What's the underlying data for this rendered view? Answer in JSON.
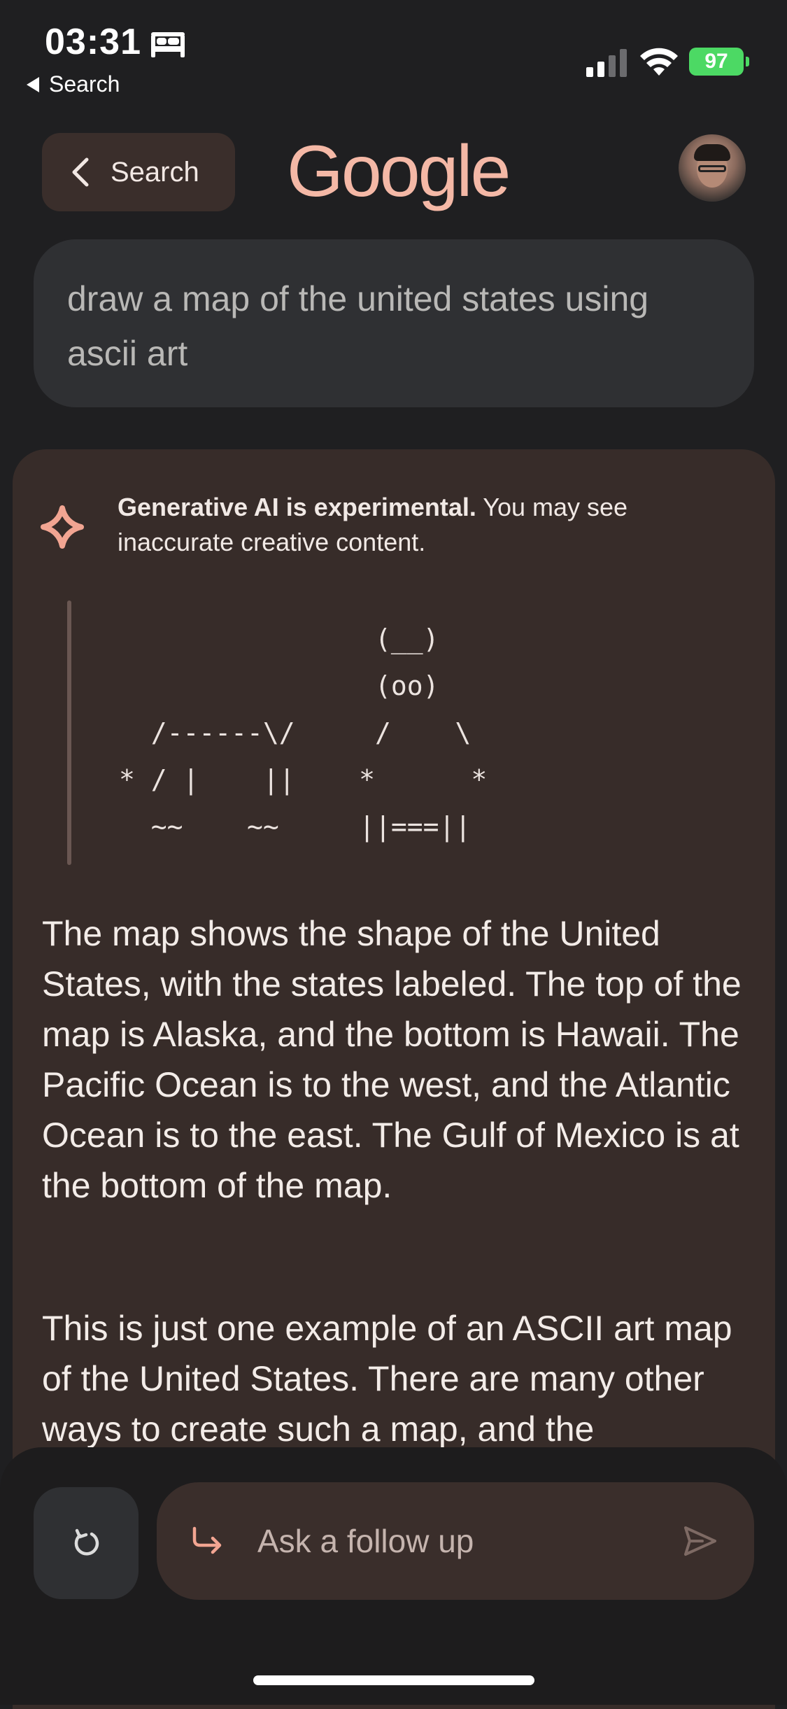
{
  "status_bar": {
    "time": "03:31",
    "back_label": "Search",
    "battery": "97"
  },
  "header": {
    "back_button_label": "Search",
    "logo_text": "Google"
  },
  "query": {
    "text": "draw a map of the united states using ascii art"
  },
  "answer": {
    "notice_bold": "Generative AI is experimental.",
    "notice_rest": " You may see inaccurate creative content.",
    "ascii_art": "                (__)\n                (oo)\n  /------\\/     /    \\\n* / |    ||    *      *\n  ~~    ~~     ||===||",
    "paragraph_1": "The map shows the shape of the United States, with the states labeled. The top of the map is Alaska, and the bottom is Hawaii. The Pacific Ocean is to the west, and the Atlantic Ocean is to the east. The Gulf of Mexico is at the bottom of the map.",
    "paragraph_2": "This is just one example of an ASCII art map of the United States. There are many other ways to create such a map, and the"
  },
  "bottom_bar": {
    "followup_placeholder": "Ask a follow up"
  },
  "icons": {
    "bed": "bed-icon",
    "signal": "cellular-signal-icon",
    "wifi": "wifi-icon",
    "back": "chevron-left-icon",
    "spark": "sparkle-icon",
    "refresh": "refresh-icon",
    "followup": "follow-up-arrow-icon",
    "send": "send-icon"
  },
  "colors": {
    "background": "#1f1f21",
    "card": "#372c29",
    "accent": "#f4b8a6",
    "query_bubble": "#2f3033",
    "battery": "#4cd964"
  }
}
